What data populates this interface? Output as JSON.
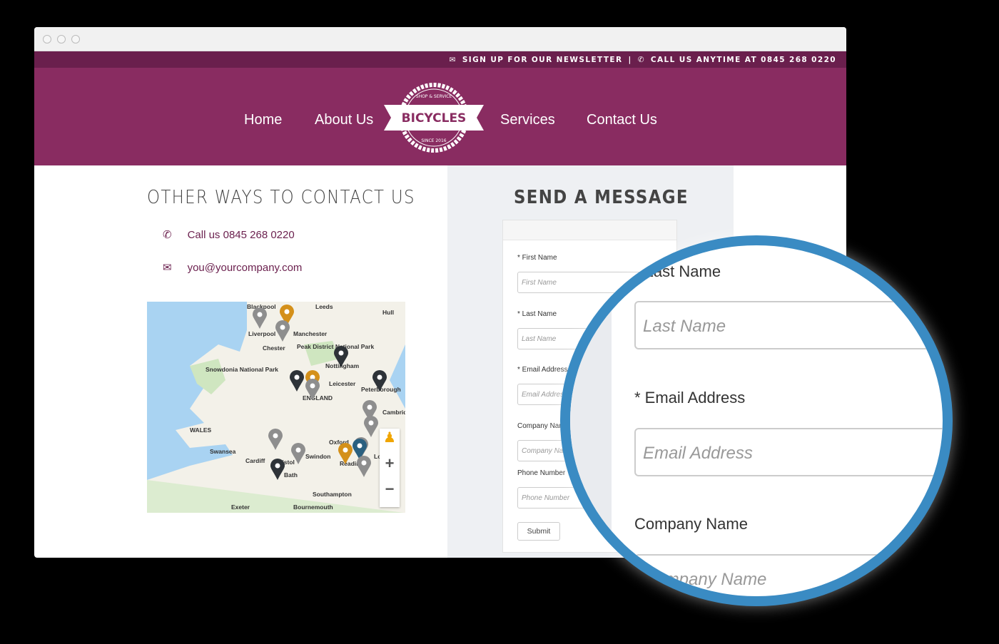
{
  "topbar": {
    "newsletter": "SIGN UP FOR OUR NEWSLETTER",
    "separator": "|",
    "call": "CALL US ANYTIME AT 0845 268 0220"
  },
  "nav": {
    "home": "Home",
    "about": "About Us",
    "services": "Services",
    "contact": "Contact Us"
  },
  "logo": {
    "top": "SHOP & SERVICE",
    "name": "BICYCLES",
    "bottom": "SINCE 2016"
  },
  "contact": {
    "title": "OTHER WAYS TO CONTACT US",
    "phone": "Call us 0845 268 0220",
    "email": "you@yourcompany.com"
  },
  "map": {
    "labels": [
      "Blackpool",
      "Leeds",
      "Hull",
      "Liverpool",
      "Manchester",
      "Chester",
      "Peak District National Park",
      "Nottingham",
      "Snowdonia National Park",
      "Leicester",
      "Peterborough",
      "ENGLAND",
      "Cambridge",
      "WALES",
      "Oxford",
      "Swansea",
      "Cardiff",
      "Swindon",
      "Bristol",
      "London",
      "Bath",
      "Reading",
      "Southampton",
      "Exeter",
      "Bournemouth"
    ],
    "zoom_in": "+",
    "zoom_out": "−"
  },
  "form": {
    "title": "SEND A MESSAGE",
    "fields": [
      {
        "label": "* First Name",
        "placeholder": "First Name"
      },
      {
        "label": "* Last Name",
        "placeholder": "Last Name"
      },
      {
        "label": "* Email Address",
        "placeholder": "Email Address"
      },
      {
        "label": "Company Name",
        "placeholder": "Company Name"
      },
      {
        "label": "Phone Number",
        "placeholder": "Phone Number"
      }
    ],
    "submit": "Submit"
  },
  "colors": {
    "brand": "#892c61",
    "topbar": "#6a1f4d",
    "magnifier": "#3a8bc3"
  }
}
